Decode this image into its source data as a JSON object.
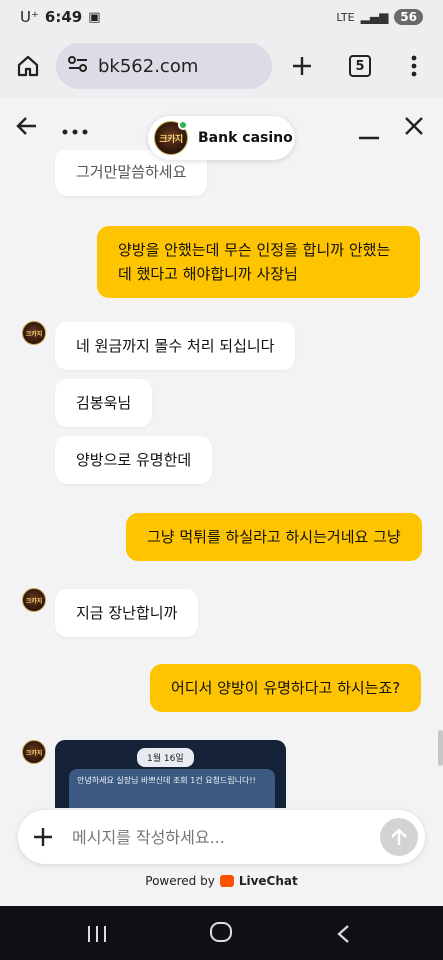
{
  "status": {
    "carrier": "U⁺",
    "time": "6:49",
    "network": "LTE",
    "battery": "56"
  },
  "browser": {
    "url": "bk562.com",
    "tab_count": "5"
  },
  "chat": {
    "title": "Bank casino",
    "messages": [
      {
        "dir": "in",
        "text": "그거만말씀하세요"
      },
      {
        "dir": "out",
        "text": "양방을 안했는데 무슨 인정을 합니까 안했는데 했다고 해야합니까 사장님"
      },
      {
        "dir": "in",
        "text": "네 원금까지 몰수 처리 되십니다"
      },
      {
        "dir": "in",
        "text": "김봉욱님"
      },
      {
        "dir": "in",
        "text": "양방으로 유명한데"
      },
      {
        "dir": "out",
        "text": "그냥 먹튀를 하실라고 하시는거네요 그냥"
      },
      {
        "dir": "in",
        "text": "지금 장난합니까"
      },
      {
        "dir": "out",
        "text": "어디서 양방이 유명하다고 하시는죠?"
      }
    ],
    "image_preview": {
      "date": "1월 16일",
      "text": "안녕하세요 실장님 바쁘신데 조회 1건 요청드립니다!!"
    }
  },
  "avatar_logo": "크카지",
  "composer": {
    "placeholder": "메시지를 작성하세요..."
  },
  "footer": {
    "powered_by": "Powered by",
    "brand": "LiveChat"
  }
}
